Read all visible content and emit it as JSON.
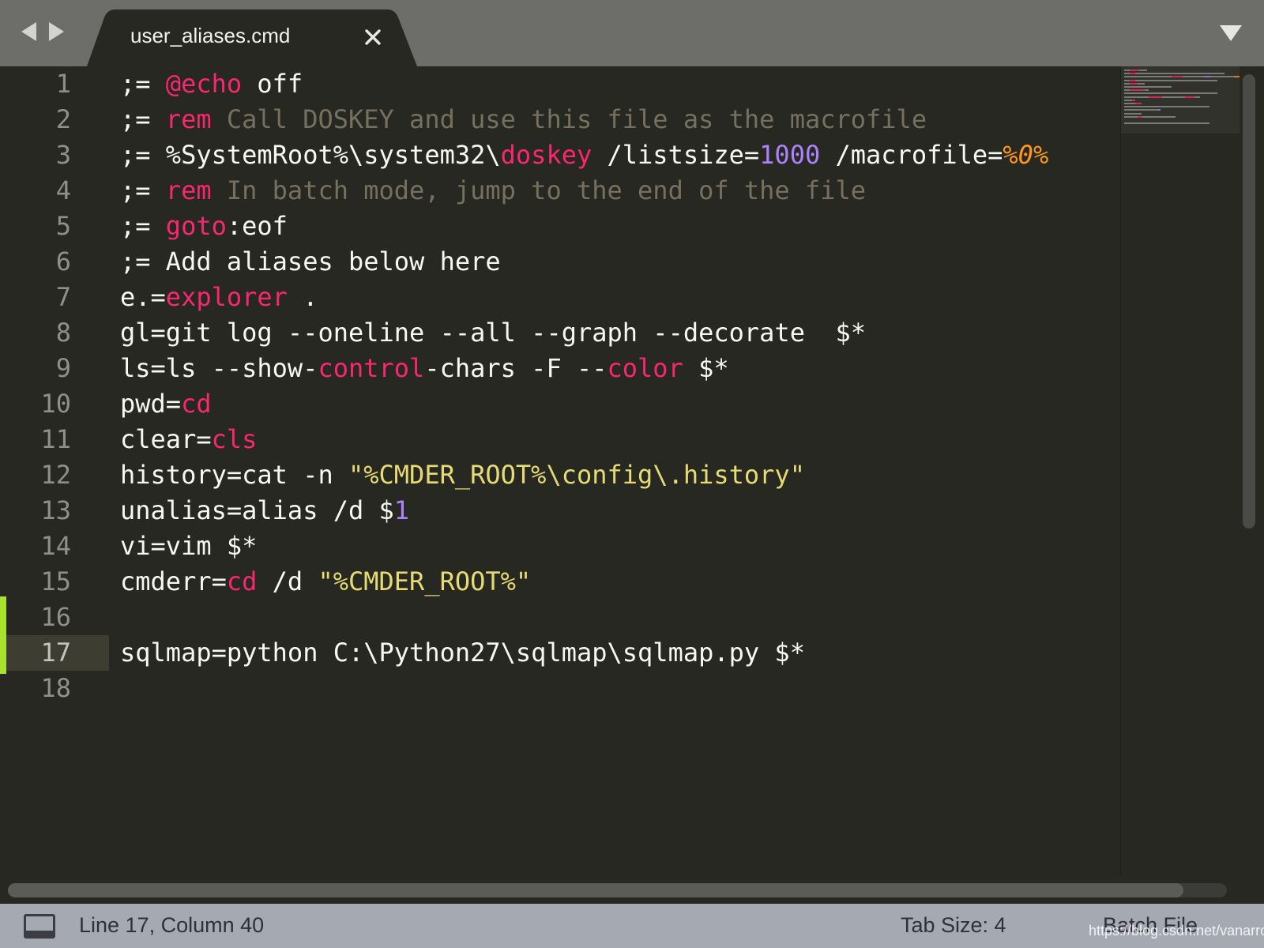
{
  "tabbar": {
    "tabs": [
      {
        "title": "user_aliases.cmd",
        "active": true
      }
    ]
  },
  "editor": {
    "current_line": 17,
    "modified_lines": [
      16,
      17
    ],
    "lines": [
      {
        "n": "1",
        "tokens": [
          {
            "t": ";= "
          },
          {
            "t": "@echo",
            "c": "kw"
          },
          {
            "t": " off"
          }
        ]
      },
      {
        "n": "2",
        "tokens": [
          {
            "t": ";= "
          },
          {
            "t": "rem",
            "c": "kw"
          },
          {
            "t": " Call DOSKEY and use this file as the macrofile",
            "c": "cm"
          }
        ]
      },
      {
        "n": "3",
        "tokens": [
          {
            "t": ";= %SystemRoot%\\system32\\"
          },
          {
            "t": "doskey",
            "c": "kw"
          },
          {
            "t": " /listsize="
          },
          {
            "t": "1000",
            "c": "num"
          },
          {
            "t": " /macrofile="
          },
          {
            "t": "%0%",
            "c": "var"
          }
        ]
      },
      {
        "n": "4",
        "tokens": [
          {
            "t": ";= "
          },
          {
            "t": "rem",
            "c": "kw"
          },
          {
            "t": " In batch mode, jump to the end of the file",
            "c": "cm"
          }
        ]
      },
      {
        "n": "5",
        "tokens": [
          {
            "t": ";= "
          },
          {
            "t": "goto",
            "c": "kw"
          },
          {
            "t": ":eof"
          }
        ]
      },
      {
        "n": "6",
        "tokens": [
          {
            "t": ";= Add aliases below here"
          }
        ]
      },
      {
        "n": "7",
        "tokens": [
          {
            "t": "e.="
          },
          {
            "t": "explorer",
            "c": "kw"
          },
          {
            "t": " ."
          }
        ]
      },
      {
        "n": "8",
        "tokens": [
          {
            "t": "gl=git log --oneline --all --graph --decorate  $*"
          }
        ]
      },
      {
        "n": "9",
        "tokens": [
          {
            "t": "ls=ls --show-"
          },
          {
            "t": "control",
            "c": "kw"
          },
          {
            "t": "-chars -F --"
          },
          {
            "t": "color",
            "c": "kw"
          },
          {
            "t": " $*"
          }
        ]
      },
      {
        "n": "10",
        "tokens": [
          {
            "t": "pwd="
          },
          {
            "t": "cd",
            "c": "kw"
          }
        ]
      },
      {
        "n": "11",
        "tokens": [
          {
            "t": "clear="
          },
          {
            "t": "cls",
            "c": "kw"
          }
        ]
      },
      {
        "n": "12",
        "tokens": [
          {
            "t": "history=cat -n "
          },
          {
            "t": "\"%CMDER_ROOT%\\config\\.history\"",
            "c": "str"
          }
        ]
      },
      {
        "n": "13",
        "tokens": [
          {
            "t": "unalias=alias /d $"
          },
          {
            "t": "1",
            "c": "num"
          }
        ]
      },
      {
        "n": "14",
        "tokens": [
          {
            "t": "vi=vim $*"
          }
        ]
      },
      {
        "n": "15",
        "tokens": [
          {
            "t": "cmderr="
          },
          {
            "t": "cd",
            "c": "kw"
          },
          {
            "t": " /d "
          },
          {
            "t": "\"%CMDER_ROOT%\"",
            "c": "str"
          }
        ]
      },
      {
        "n": "16",
        "tokens": []
      },
      {
        "n": "17",
        "tokens": [
          {
            "t": "sqlmap=python C:\\Python27\\sqlmap\\sqlmap.py $*"
          }
        ]
      },
      {
        "n": "18",
        "tokens": []
      }
    ]
  },
  "statusbar": {
    "position": "Line 17, Column 40",
    "tab_size": "Tab Size: 4",
    "syntax": "Batch File",
    "watermark": "https://blog.csdn.net/vanarrow"
  },
  "icons": {
    "back": "nav-back-icon",
    "forward": "nav-forward-icon",
    "close": "close-icon",
    "tabs_menu": "chevron-down-icon",
    "panel": "panel-toggle-icon"
  },
  "colors": {
    "background": "#272822",
    "foreground": "#f8f8f2",
    "keyword": "#f92672",
    "comment": "#75715e",
    "number": "#ae81ff",
    "string": "#e6db74",
    "variable": "#fd971f",
    "modified_marker": "#a6e22e",
    "tabbar": "#6d6e6a",
    "statusbar": "#a4a9b2"
  }
}
